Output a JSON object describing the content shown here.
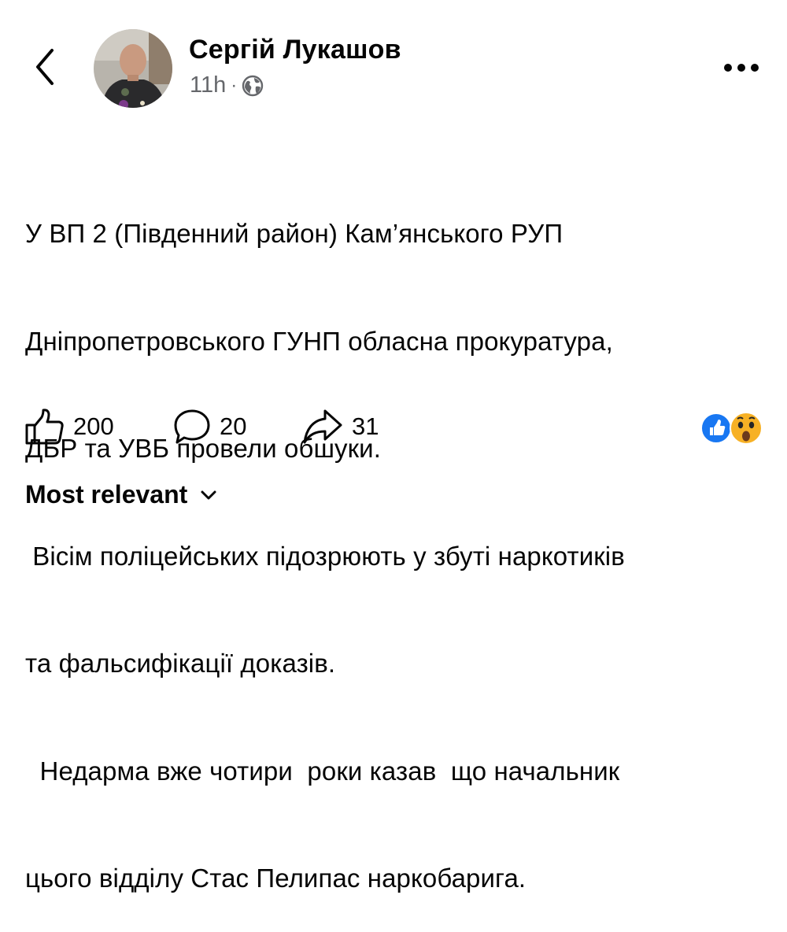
{
  "header": {
    "back_icon": "chevron-left-icon",
    "author_name": "Сергій Лукашов",
    "timestamp": "11h",
    "separator": "·",
    "audience_icon": "globe-icon",
    "more_icon": "more-options-icon"
  },
  "post": {
    "lines": [
      "У ВП 2 (Південний район) Кам’янського РУП",
      "Дніпропетровського ГУНП обласна прокуратура,",
      "ДБР та УВБ провели обшуки.",
      " Вісім поліцейських підозрюють у збуті наркотиків",
      "та фальсифікації доказів.",
      "  Недарма вже чотири  роки казав  що начальник",
      "цього відділу Стас Пелипас наркобарига."
    ]
  },
  "actions": {
    "like_count": "200",
    "comment_count": "20",
    "share_count": "31"
  },
  "reactions": [
    "like",
    "wow"
  ],
  "colors": {
    "text": "#050505",
    "secondary": "#65676b",
    "like_blue": "#1877f2",
    "wow_yellow": "#f7b125"
  },
  "comments": {
    "sort_label": "Most relevant"
  }
}
